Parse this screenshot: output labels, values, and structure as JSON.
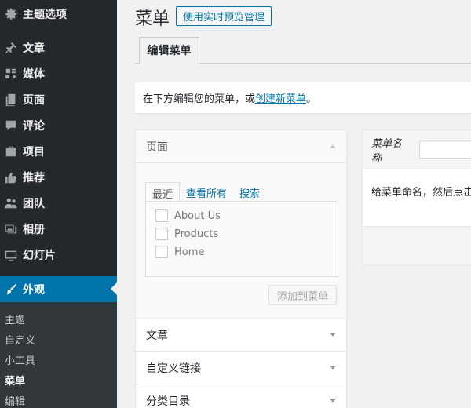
{
  "sidebar": {
    "items": [
      {
        "label": "主题选项",
        "icon": "gear-icon"
      },
      {
        "label": "文章",
        "icon": "pin-icon"
      },
      {
        "label": "媒体",
        "icon": "media-icon"
      },
      {
        "label": "页面",
        "icon": "pages-icon"
      },
      {
        "label": "评论",
        "icon": "comment-icon"
      },
      {
        "label": "项目",
        "icon": "portfolio-icon"
      },
      {
        "label": "推荐",
        "icon": "thumbs-up-icon"
      },
      {
        "label": "团队",
        "icon": "groups-icon"
      },
      {
        "label": "相册",
        "icon": "gallery-icon"
      },
      {
        "label": "幻灯片",
        "icon": "slides-icon"
      },
      {
        "label": "外观",
        "icon": "brush-icon"
      }
    ],
    "submenu": [
      "主题",
      "自定义",
      "小工具",
      "菜单",
      "编辑"
    ],
    "active_color": "#0073aa"
  },
  "header": {
    "title": "菜单",
    "action_label": "使用实时预览管理"
  },
  "tabs": {
    "edit_menus": "编辑菜单"
  },
  "notice": {
    "prefix": "在下方编辑您的菜单，或",
    "link": "创建新菜单",
    "suffix": "。"
  },
  "accordion": {
    "pages_title": "页面",
    "subtabs": [
      "最近",
      "查看所有",
      "搜索"
    ],
    "items": [
      "About Us",
      "Products",
      "Home"
    ],
    "add_button": "添加到菜单",
    "sections": [
      "文章",
      "自定义链接",
      "分类目录"
    ]
  },
  "menu_panel": {
    "name_label": "菜单名称",
    "hint": "给菜单命名，然后点击"
  }
}
